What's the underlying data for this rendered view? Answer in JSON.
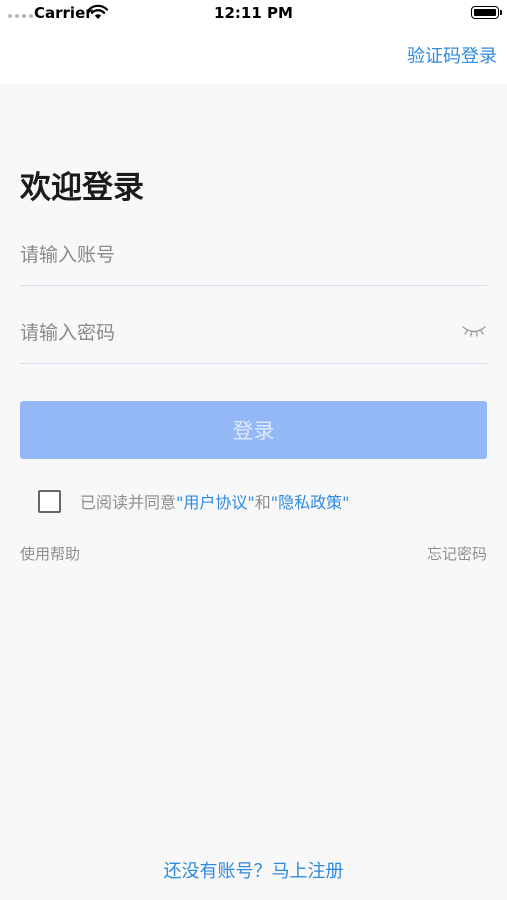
{
  "status_bar": {
    "carrier": "Carrier",
    "time": "12:11 PM"
  },
  "nav": {
    "code_login_label": "验证码登录"
  },
  "form": {
    "title": "欢迎登录",
    "account_placeholder": "请输入账号",
    "account_value": "",
    "password_placeholder": "请输入密码",
    "password_value": "",
    "login_label": "登录"
  },
  "agreement": {
    "checked": false,
    "prefix": "已阅读并同意",
    "user_agreement": "\"用户协议\"",
    "conjunction": "和",
    "privacy_policy": "\"隐私政策\""
  },
  "links": {
    "help": "使用帮助",
    "forgot": "忘记密码",
    "register": "还没有账号？马上注册"
  },
  "icons": {
    "eye": "eye-closed-icon",
    "wifi": "wifi-icon",
    "battery": "battery-icon",
    "signal": "signal-icon"
  },
  "colors": {
    "accent": "#2f8be0",
    "button_disabled": "#93b8f5",
    "background": "#f8f8f8"
  }
}
